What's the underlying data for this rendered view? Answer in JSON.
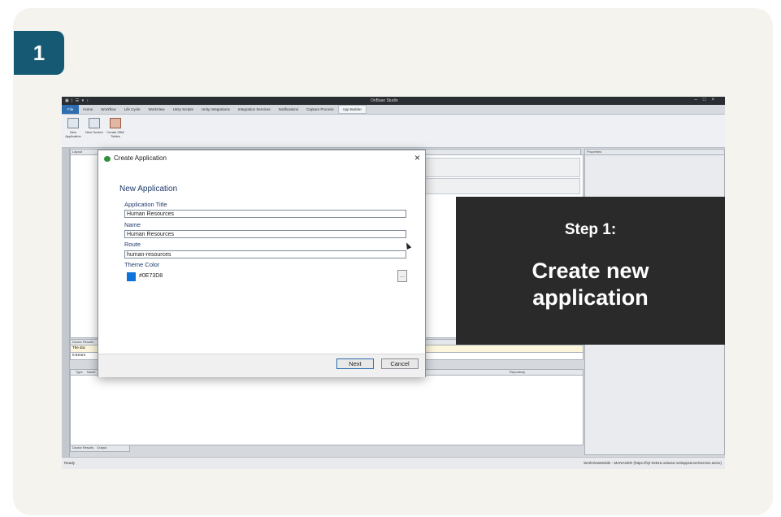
{
  "step_number": "1",
  "app": {
    "window_title": "OnBase Studio",
    "quick_access": "▣ | ☰ ▾ ↕",
    "window_controls": "–□×",
    "file_tab": "File",
    "ribbon_tabs": [
      "Home",
      "Workflow",
      "Life Cycle",
      "WorkView",
      "Unity Scripts",
      "Unity Integrations",
      "Integration Services",
      "Notifications",
      "Capture Process"
    ],
    "active_tab": "App Builder",
    "ribbon_buttons": [
      {
        "label": "New Application",
        "icon": "new-application-icon"
      },
      {
        "label": "New Screen",
        "icon": "new-screen-icon"
      },
      {
        "label": "Create OBA Tables",
        "icon": "create-tables-icon"
      }
    ],
    "layout_panel_title": "Layout",
    "properties_panel_title": "Properties",
    "doctor_results_title": "Doctor Results",
    "doctor_info_text": "The doc",
    "errors_text": "0 Errors",
    "results_headers": [
      "Type",
      "Name"
    ],
    "repository_header": "Repository",
    "bottom_tabs": [
      "Doctor Results",
      "Output"
    ],
    "status_left": "Ready",
    "status_right": "WorkViewMobile - MANAGER (https://hyl-04916.onbase.net/appserver/service.asmx)",
    "accent_color": "#2e6db0"
  },
  "dialog": {
    "title": "Create Application",
    "close_symbol": "×",
    "section_title": "New Application",
    "fields": [
      {
        "label": "Application Title",
        "value": "Human Resources"
      },
      {
        "label": "Name",
        "value": "Human Resources"
      },
      {
        "label": "Route",
        "value": "human-resources"
      }
    ],
    "theme_color_label": "Theme Color",
    "theme_color_value": "#0E73D8",
    "browse_button": "...",
    "next_button": "Next",
    "cancel_button": "Cancel"
  },
  "overlay": {
    "step_label": "Step 1:",
    "line1": "Create new",
    "line2": "application",
    "background": "#2a2a2a"
  },
  "badge_color": "#155a72"
}
